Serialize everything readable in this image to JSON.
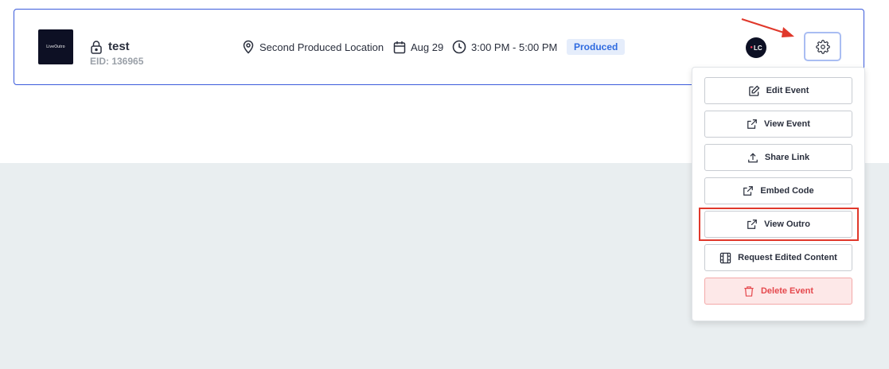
{
  "event": {
    "title": "test",
    "eid": "EID: 136965",
    "location": "Second Produced Location",
    "date": "Aug 29",
    "time": "3:00 PM - 5:00 PM",
    "status": "Produced",
    "avatar_initials": "LC",
    "thumbnail_text": "LiveOutro"
  },
  "menu": {
    "items": [
      {
        "label": "Edit Event",
        "icon": "edit-icon"
      },
      {
        "label": "View Event",
        "icon": "external-link-icon"
      },
      {
        "label": "Share Link",
        "icon": "upload-icon"
      },
      {
        "label": "Embed Code",
        "icon": "external-link-icon"
      },
      {
        "label": "View Outro",
        "icon": "external-link-icon"
      },
      {
        "label": "Request Edited Content",
        "icon": "film-icon"
      },
      {
        "label": "Delete Event",
        "icon": "trash-icon"
      }
    ]
  },
  "colors": {
    "accent": "#3b5bdb",
    "badge_text": "#2f6be0",
    "danger": "#e5484d",
    "annotation": "#e0382b"
  }
}
